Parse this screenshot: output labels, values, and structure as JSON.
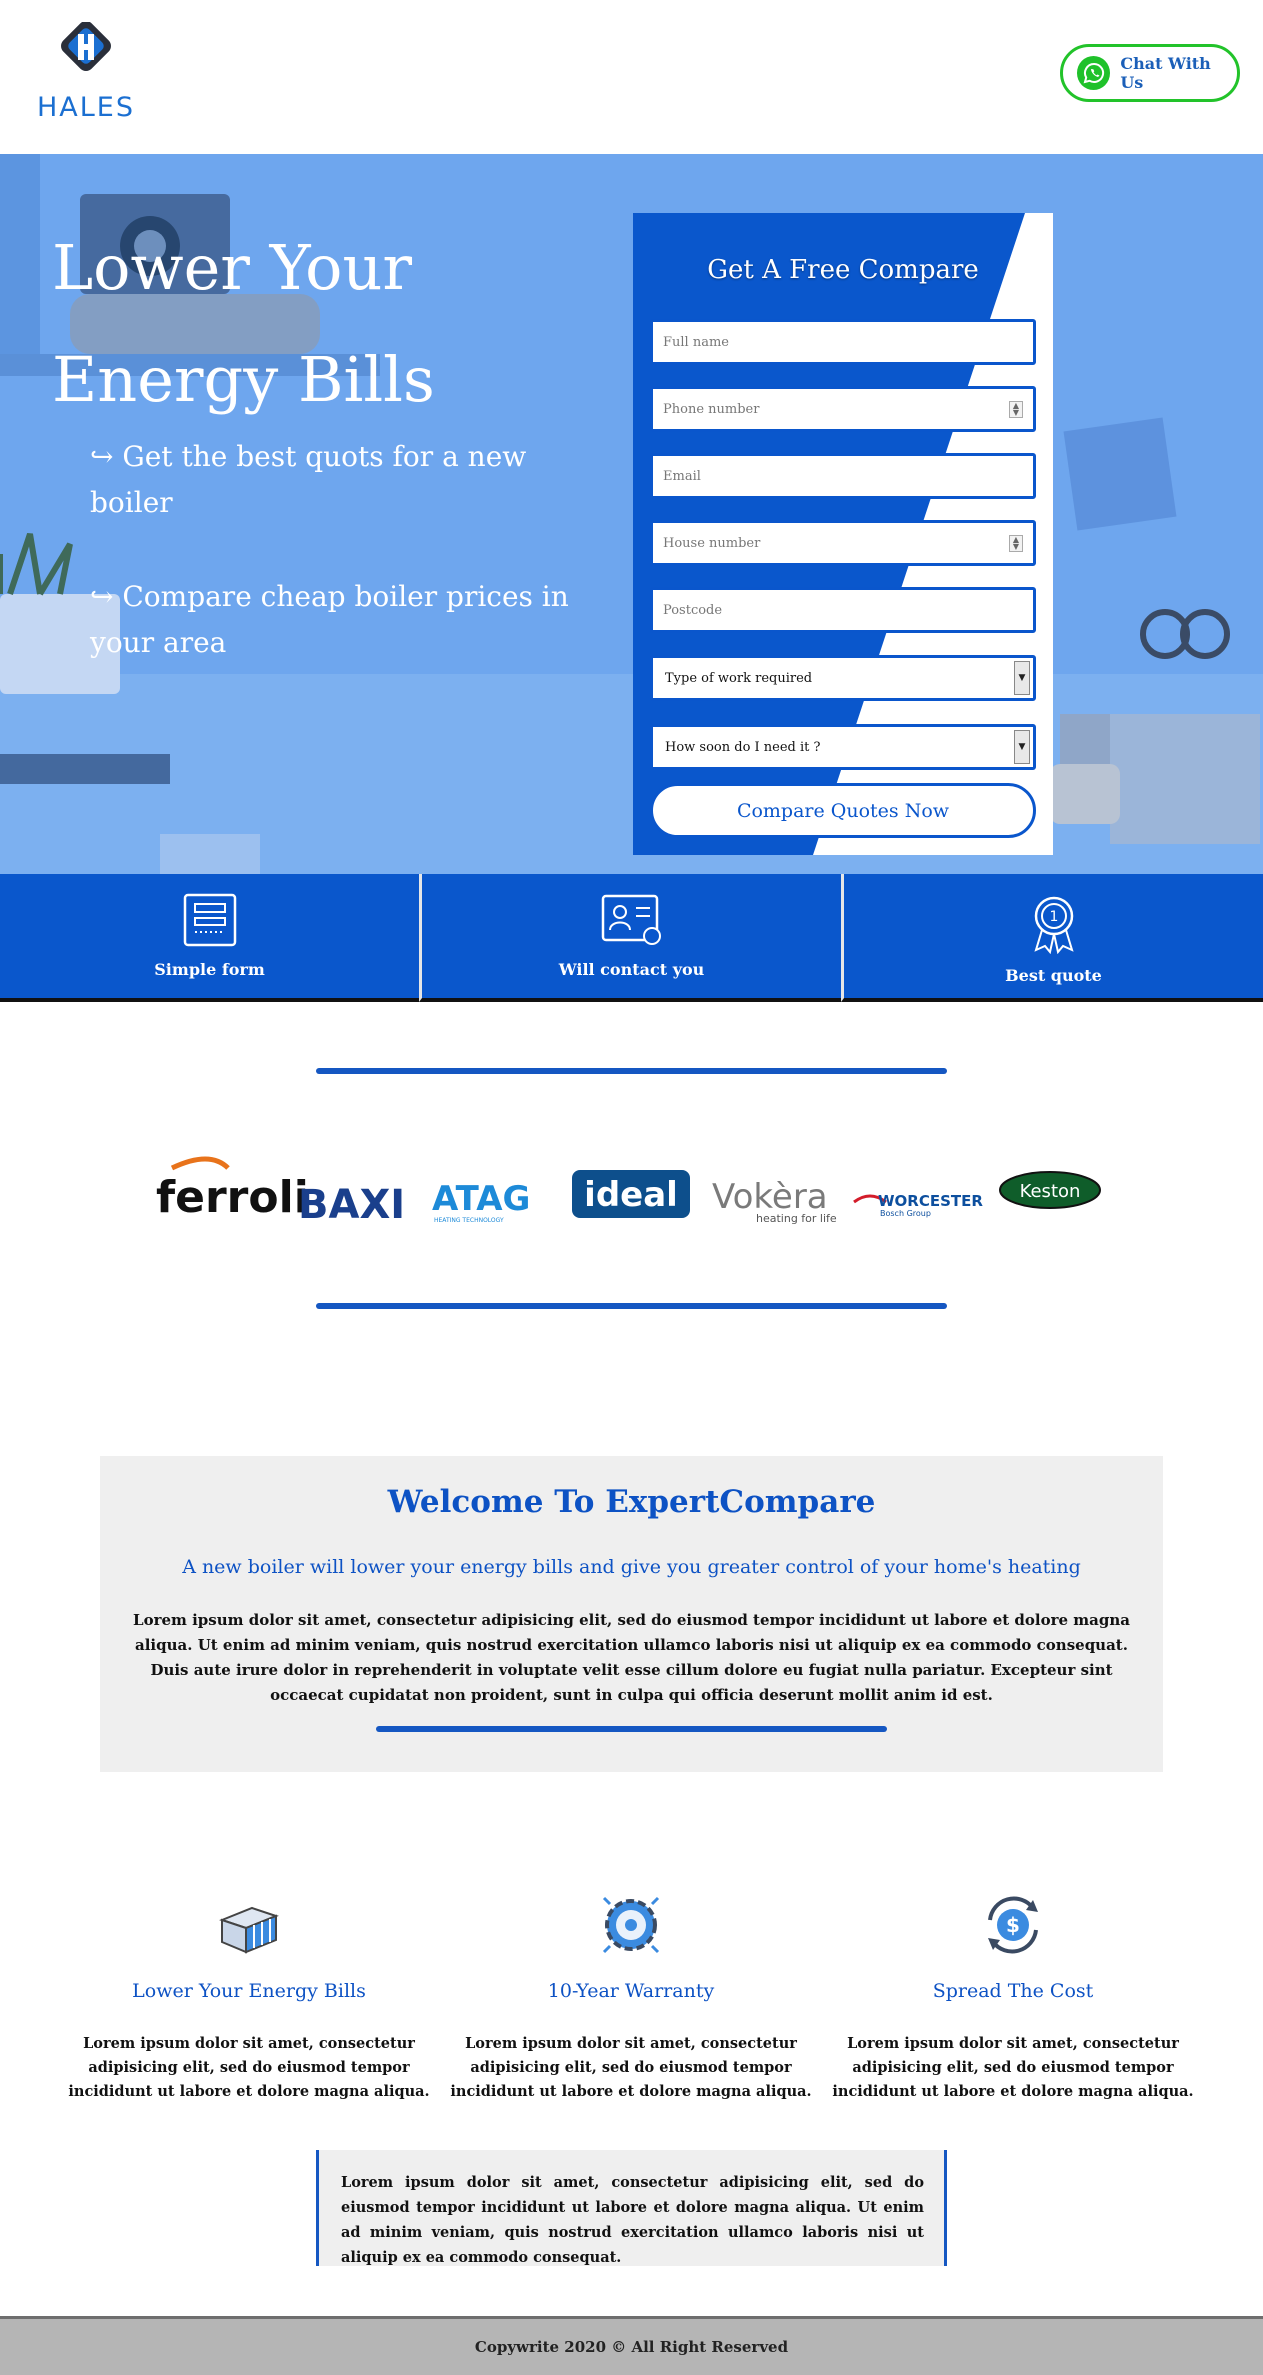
{
  "header": {
    "logo_text": "HALES",
    "chat_label": "Chat With Us"
  },
  "hero": {
    "title_line1": "Lower Your",
    "title_line2": "Energy Bills",
    "points": [
      "↪ Get the best quots for a new boiler",
      "↪ Compare cheap boiler prices in your area"
    ]
  },
  "form": {
    "title": "Get A Free Compare",
    "fields": {
      "full_name": "Full name",
      "phone": "Phone number",
      "email": "Email",
      "house": "House number",
      "postcode": "Postcode"
    },
    "selects": {
      "work": "Type of work required",
      "when": "How soon do I need it ?"
    },
    "submit": "Compare Quotes Now"
  },
  "features": [
    "Simple form",
    "Will contact you",
    "Best quote"
  ],
  "brands": [
    "ferroli",
    "BAXI",
    "ATAG",
    "HEATING TECHNOLOGY",
    "ideal",
    "Vokèra",
    "heating for life",
    "WORCESTER",
    "Bosch Group",
    "Keston"
  ],
  "welcome": {
    "title": "Welcome To ExpertCompare",
    "subtitle": "A new boiler will lower your energy bills and give you greater control of your home's heating",
    "body": "Lorem ipsum dolor sit amet, consectetur adipisicing elit, sed do eiusmod tempor incididunt ut labore et dolore magna aliqua. Ut enim ad minim veniam, quis nostrud exercitation ullamco laboris nisi ut aliquip ex ea commodo consequat. Duis aute irure dolor in reprehenderit in voluptate velit esse cillum dolore eu fugiat nulla pariatur. Excepteur sint occaecat cupidatat non proident, sunt in culpa qui officia deserunt mollit anim id est."
  },
  "benefits": [
    {
      "title": "Lower Your Energy Bills",
      "text": "Lorem ipsum dolor sit amet, consectetur adipisicing elit, sed do eiusmod tempor incididunt ut labore et dolore magna aliqua."
    },
    {
      "title": "10-Year Warranty",
      "text": "Lorem ipsum dolor sit amet, consectetur adipisicing elit, sed do eiusmod tempor incididunt ut labore et dolore magna aliqua."
    },
    {
      "title": "Spread The Cost",
      "text": "Lorem ipsum dolor sit amet, consectetur adipisicing elit, sed do eiusmod tempor incididunt ut labore et dolore magna aliqua."
    }
  ],
  "quote": "Lorem ipsum dolor sit amet, consectetur adipisicing elit, sed do eiusmod tempor incididunt ut labore et dolore magna aliqua. Ut enim ad minim veniam, quis nostrud exercitation ullamco laboris nisi ut aliquip ex ea commodo consequat.",
  "footer": "Copywrite 2020 © All Right Reserved",
  "colors": {
    "primary": "#0a57cc",
    "hero_overlay": "#6ea6ee",
    "whatsapp": "#22c32a",
    "panel": "#efefef",
    "footer": "#b5b5b5"
  }
}
